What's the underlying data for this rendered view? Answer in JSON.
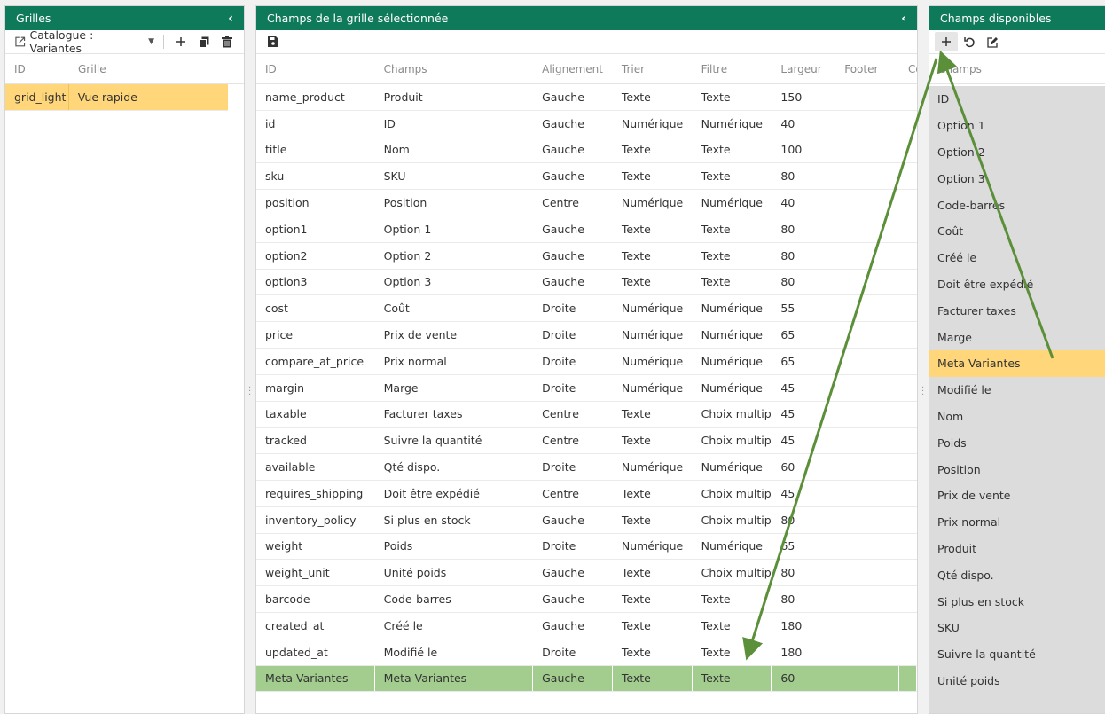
{
  "left_panel": {
    "title": "Grilles",
    "selector_value": "Catalogue : Variantes",
    "columns": [
      "ID",
      "Grille"
    ],
    "rows": [
      {
        "id": "grid_light",
        "grille": "Vue rapide"
      }
    ]
  },
  "middle_panel": {
    "title": "Champs de la grille sélectionnée",
    "columns": [
      "ID",
      "Champs",
      "Alignement",
      "Trier",
      "Filtre",
      "Largeur",
      "Footer",
      "Co"
    ],
    "rows": [
      [
        "name_product",
        "Produit",
        "Gauche",
        "Texte",
        "Texte",
        "150"
      ],
      [
        "id",
        "ID",
        "Gauche",
        "Numérique",
        "Numérique",
        "40"
      ],
      [
        "title",
        "Nom",
        "Gauche",
        "Texte",
        "Texte",
        "100"
      ],
      [
        "sku",
        "SKU",
        "Gauche",
        "Texte",
        "Texte",
        "80"
      ],
      [
        "position",
        "Position",
        "Centre",
        "Numérique",
        "Numérique",
        "40"
      ],
      [
        "option1",
        "Option 1",
        "Gauche",
        "Texte",
        "Texte",
        "80"
      ],
      [
        "option2",
        "Option 2",
        "Gauche",
        "Texte",
        "Texte",
        "80"
      ],
      [
        "option3",
        "Option 3",
        "Gauche",
        "Texte",
        "Texte",
        "80"
      ],
      [
        "cost",
        "Coût",
        "Droite",
        "Numérique",
        "Numérique",
        "55"
      ],
      [
        "price",
        "Prix de vente",
        "Droite",
        "Numérique",
        "Numérique",
        "65"
      ],
      [
        "compare_at_price",
        "Prix normal",
        "Droite",
        "Numérique",
        "Numérique",
        "65"
      ],
      [
        "margin",
        "Marge",
        "Droite",
        "Numérique",
        "Numérique",
        "45"
      ],
      [
        "taxable",
        "Facturer taxes",
        "Centre",
        "Texte",
        "Choix multiple",
        "45"
      ],
      [
        "tracked",
        "Suivre la quantité",
        "Centre",
        "Texte",
        "Choix multiple",
        "45"
      ],
      [
        "available",
        "Qté dispo.",
        "Droite",
        "Numérique",
        "Numérique",
        "60"
      ],
      [
        "requires_shipping",
        "Doit être expédié",
        "Centre",
        "Texte",
        "Choix multiple",
        "45"
      ],
      [
        "inventory_policy",
        "Si plus en stock",
        "Gauche",
        "Texte",
        "Choix multiple",
        "80"
      ],
      [
        "weight",
        "Poids",
        "Droite",
        "Numérique",
        "Numérique",
        "65"
      ],
      [
        "weight_unit",
        "Unité poids",
        "Gauche",
        "Texte",
        "Choix multiple",
        "80"
      ],
      [
        "barcode",
        "Code-barres",
        "Gauche",
        "Texte",
        "Texte",
        "80"
      ],
      [
        "created_at",
        "Créé le",
        "Gauche",
        "Texte",
        "Texte",
        "180"
      ],
      [
        "updated_at",
        "Modifié le",
        "Droite",
        "Texte",
        "Texte",
        "180"
      ],
      [
        "Meta Variantes",
        "Meta Variantes",
        "Gauche",
        "Texte",
        "Texte",
        "60"
      ]
    ]
  },
  "right_panel": {
    "title": "Champs disponibles",
    "column_header": "Champs",
    "items": [
      "ID",
      "Option 1",
      "Option 2",
      "Option 3",
      "Code-barres",
      "Coût",
      "Créé le",
      "Doit être expédié",
      "Facturer taxes",
      "Marge",
      "Meta Variantes",
      "Modifié le",
      "Nom",
      "Poids",
      "Position",
      "Prix de vente",
      "Prix normal",
      "Produit",
      "Qté dispo.",
      "Si plus en stock",
      "SKU",
      "Suivre la quantité",
      "Unité poids"
    ],
    "selected_index": 10
  },
  "colors": {
    "header_green": "#0f7a5a",
    "selected_yellow": "#ffd77a",
    "added_row_green": "#a2cd8e",
    "arrow_green": "#5c8f3a"
  }
}
